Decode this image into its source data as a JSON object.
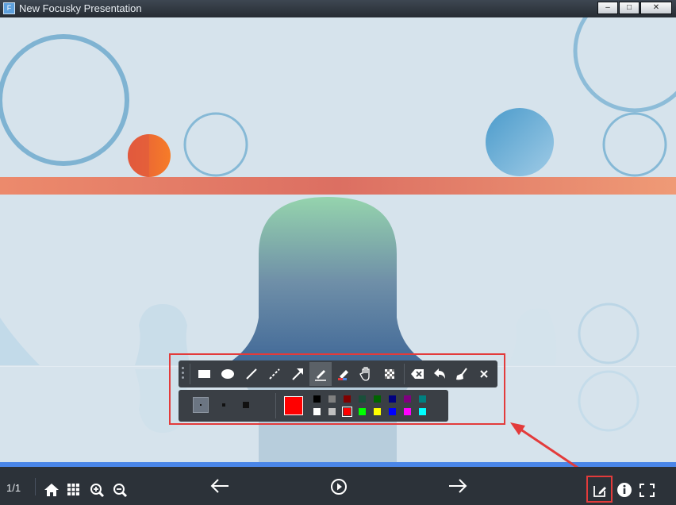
{
  "window": {
    "title": "New Focusky Presentation",
    "app_icon_glyph": "F",
    "min_glyph": "–",
    "max_glyph": "□",
    "close_glyph": "✕"
  },
  "bottom_bar": {
    "page_indicator": "1/1"
  },
  "draw_toolbar": {
    "tools": [
      {
        "name": "rectangle-tool",
        "icon": "rectangle-icon"
      },
      {
        "name": "ellipse-tool",
        "icon": "ellipse-icon"
      },
      {
        "name": "line-tool",
        "icon": "line-icon"
      },
      {
        "name": "dashed-line-tool",
        "icon": "dashed-line-icon"
      },
      {
        "name": "arrow-tool",
        "icon": "arrow-icon"
      },
      {
        "name": "pen-tool",
        "icon": "pen-icon",
        "active": true
      },
      {
        "name": "highlighter-tool",
        "icon": "highlighter-icon"
      },
      {
        "name": "hand-tool",
        "icon": "hand-icon"
      },
      {
        "name": "mosaic-tool",
        "icon": "mosaic-icon"
      },
      {
        "name": "eraser-tool",
        "icon": "eraser-icon"
      },
      {
        "name": "undo-tool",
        "icon": "undo-icon"
      },
      {
        "name": "clear-tool",
        "icon": "broom-icon"
      },
      {
        "name": "close-toolbar",
        "icon": "close-icon"
      }
    ],
    "current_color": "#ff0000",
    "palette": [
      [
        "#000000",
        "#808080",
        "#800000",
        "#1a4f3a",
        "#006400",
        "#000080",
        "#800080",
        "#008080"
      ],
      [
        "#ffffff",
        "#c0c0c0",
        "#ff0000",
        "#00ff00",
        "#ffff00",
        "#0000ff",
        "#ff00ff",
        "#00ffff"
      ]
    ],
    "selected_swatch": "#ff0000"
  },
  "colors": {
    "highlight": "#e33b3b",
    "stage_bg": "#d8e5ee",
    "orange_bar": "#e8836a",
    "bottom_bar_bg": "#2c3239"
  }
}
